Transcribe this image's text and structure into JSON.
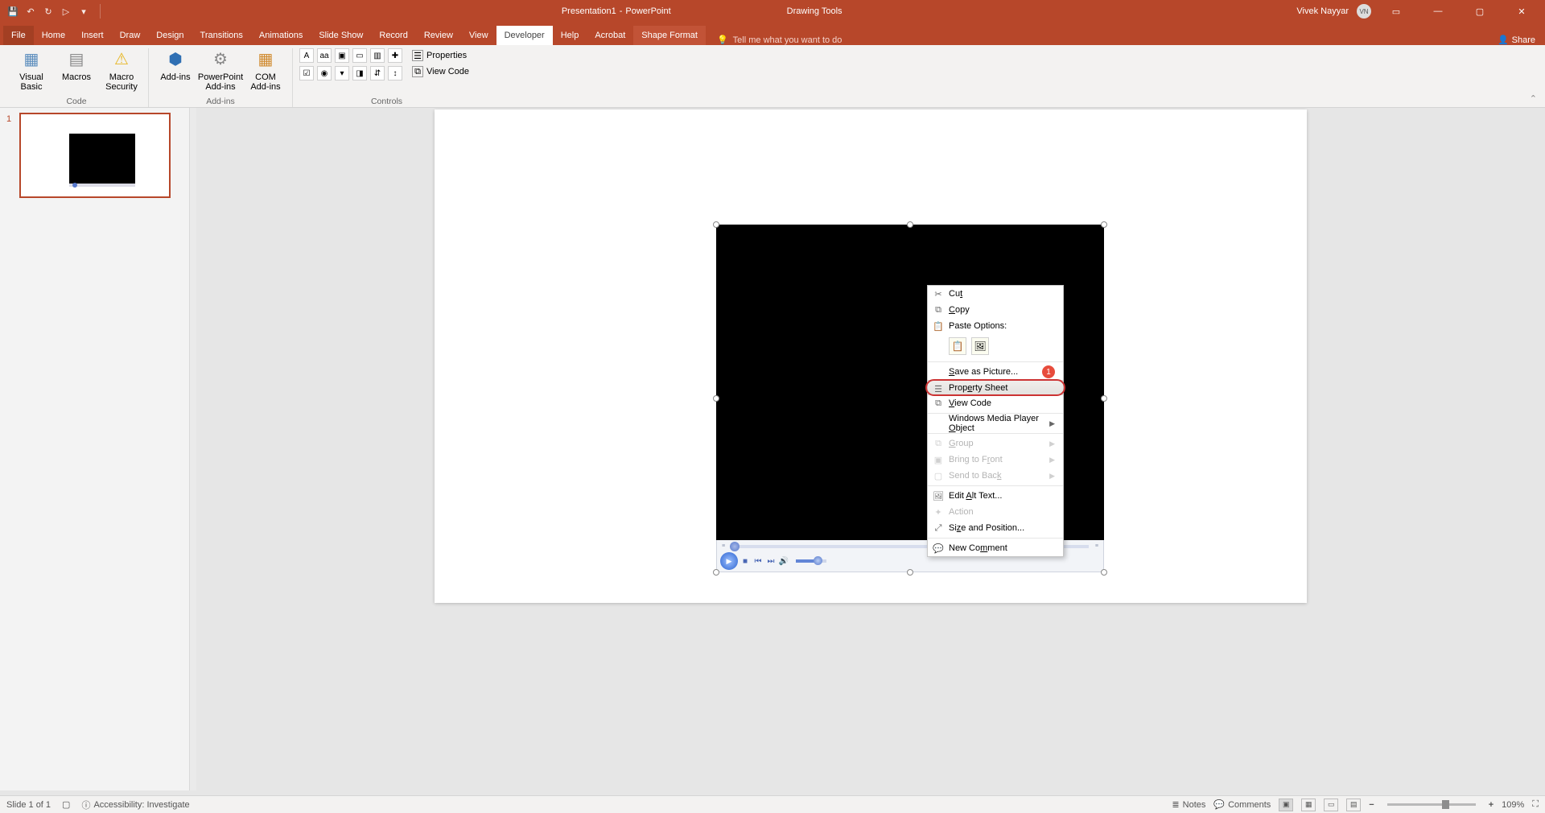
{
  "title": {
    "doc": "Presentation1",
    "app": "PowerPoint",
    "tool_context": "Drawing Tools",
    "user": "Vivek Nayyar",
    "initials": "VN"
  },
  "tabs": {
    "file": "File",
    "home": "Home",
    "insert": "Insert",
    "draw": "Draw",
    "design": "Design",
    "transitions": "Transitions",
    "animations": "Animations",
    "slideshow": "Slide Show",
    "record": "Record",
    "review": "Review",
    "view": "View",
    "developer": "Developer",
    "help": "Help",
    "acrobat": "Acrobat",
    "shape_format": "Shape Format",
    "tell_me": "Tell me what you want to do",
    "share": "Share"
  },
  "ribbon": {
    "code": {
      "visual_basic": "Visual Basic",
      "macros": "Macros",
      "macro_security": "Macro Security",
      "label": "Code"
    },
    "addins": {
      "addins": "Add-ins",
      "ppt_addins": "PowerPoint Add-ins",
      "com_addins": "COM Add-ins",
      "label": "Add-ins"
    },
    "controls": {
      "properties": "Properties",
      "view_code": "View Code",
      "label": "Controls"
    }
  },
  "thumb": {
    "num": "1"
  },
  "context": {
    "cut": "Cut",
    "copy": "Copy",
    "paste_options": "Paste Options:",
    "save_pic": "Save as Picture...",
    "save_badge": "1",
    "property": "Property Sheet",
    "view_code": "View Code",
    "wmp": "Windows Media Player Object",
    "group": "Group",
    "front": "Bring to Front",
    "back": "Send to Back",
    "alt": "Edit Alt Text...",
    "action": "Action",
    "size": "Size and Position...",
    "comment": "New Comment"
  },
  "status": {
    "slide": "Slide 1 of 1",
    "acc": "Accessibility: Investigate",
    "notes": "Notes",
    "comments": "Comments",
    "zoom": "109%"
  }
}
